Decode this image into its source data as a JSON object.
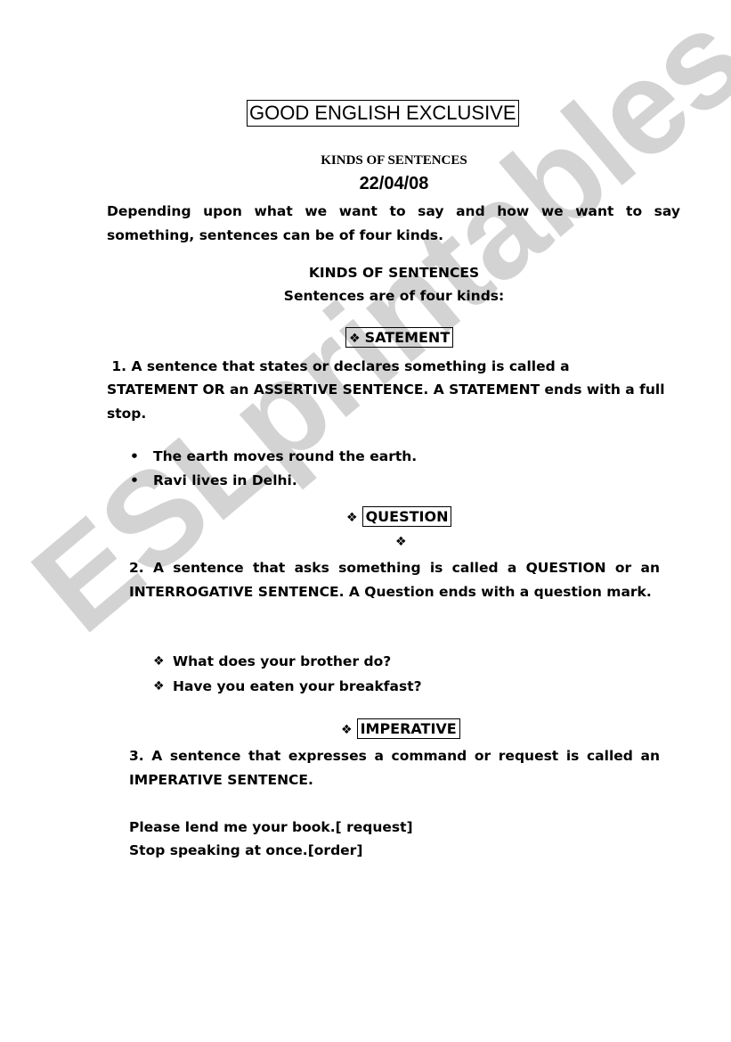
{
  "watermark": "ESLprintables.com",
  "header": {
    "title": "GOOD ENGLISH EXCLUSIVE",
    "subtitle": "KINDS OF SENTENCES",
    "date": "22/04/08"
  },
  "intro": {
    "text": "Depending upon what we want to say and how we want to say something, sentences can be of four kinds."
  },
  "section_heading": {
    "title": "KINDS OF SENTENCES",
    "subtitle": "Sentences are of four kinds:"
  },
  "icons": {
    "diamond": "❖",
    "bullet": "•"
  },
  "sections": [
    {
      "heading": "SATEMENT",
      "definition_line1": " 1. A sentence that states or declares something is called a",
      "definition_rest": "STATEMENT OR an ASSERTIVE SENTENCE. A STATEMENT ends with a full stop.",
      "examples": [
        "The earth moves round the earth.",
        "Ravi lives in Delhi."
      ]
    },
    {
      "heading": "QUESTION",
      "definition": "2. A sentence that asks something is called a QUESTION or an INTERROGATIVE SENTENCE. A Question ends with a question mark.",
      "examples": [
        "What does your brother do?",
        "Have you eaten your breakfast?"
      ]
    },
    {
      "heading": "IMPERATIVE",
      "definition": "3. A sentence that expresses a command or request is called an IMPERATIVE SENTENCE.",
      "examples": [
        "Please lend me your book.[ request]",
        "Stop speaking at once.[order]"
      ]
    }
  ]
}
